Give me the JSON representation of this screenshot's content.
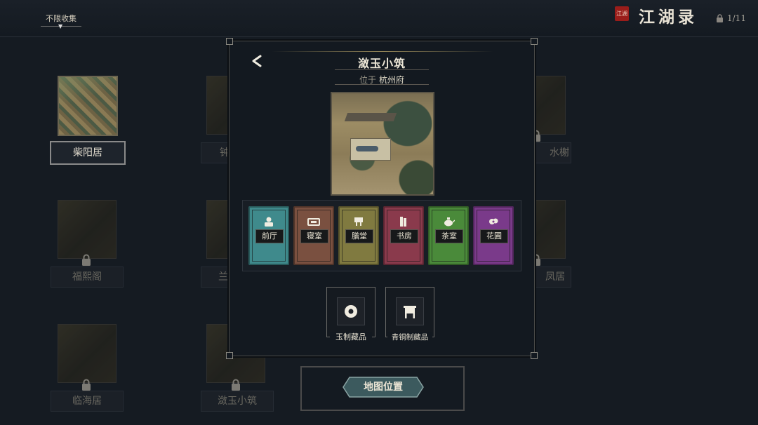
{
  "header": {
    "filter_label": "不限收集",
    "app_title": "江湖录",
    "seal_text": "江湖",
    "progress_count": "1/11"
  },
  "background_grid": {
    "items": [
      {
        "name": "柴阳居",
        "unlocked": true
      },
      {
        "name": "钟",
        "unlocked": false
      },
      {
        "name": "水榭",
        "unlocked": false
      },
      {
        "name": "福熙阁",
        "unlocked": false
      },
      {
        "name": "兰",
        "unlocked": false
      },
      {
        "name": "凤居",
        "unlocked": false
      },
      {
        "name": "临海居",
        "unlocked": false
      },
      {
        "name": "潋玉小筑",
        "unlocked": false
      }
    ]
  },
  "modal": {
    "title": "潋玉小筑",
    "location_prefix": "位于",
    "location_city": "杭州府",
    "rooms": [
      {
        "label": "前厅",
        "color": "#3f8a8c",
        "icon": "person-icon"
      },
      {
        "label": "寝室",
        "color": "#7a5040",
        "icon": "bed-icon"
      },
      {
        "label": "膳堂",
        "color": "#807a40",
        "icon": "table-icon"
      },
      {
        "label": "书房",
        "color": "#8a3a4c",
        "icon": "book-icon"
      },
      {
        "label": "茶室",
        "color": "#4a8a3a",
        "icon": "teapot-icon"
      },
      {
        "label": "花圃",
        "color": "#7a3a8a",
        "icon": "flower-icon"
      }
    ],
    "collections": [
      {
        "label": "玉制藏品",
        "icon": "jade-disc-icon"
      },
      {
        "label": "青铜制藏品",
        "icon": "bronze-ding-icon"
      }
    ]
  },
  "footer": {
    "map_button_label": "地图位置"
  }
}
